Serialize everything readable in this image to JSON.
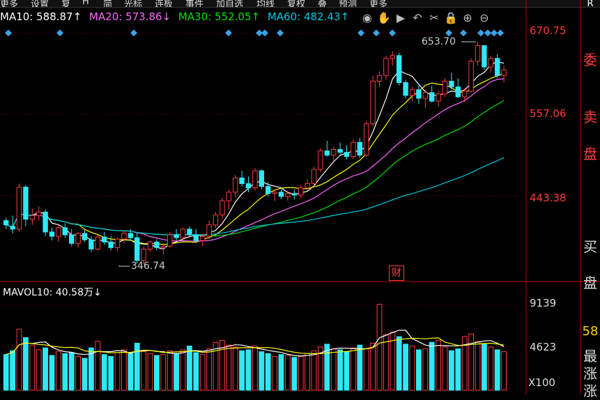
{
  "topbar": {
    "items": [
      "更多",
      "设置",
      "复",
      "H",
      "简",
      "光标",
      "连板",
      "事件",
      "加自选",
      "均线",
      "复权",
      "叠",
      "预测",
      "更多"
    ]
  },
  "legend": {
    "ma10": "MA10: 588.87↑",
    "ma20": "MA20: 573.86↓",
    "ma30": "MA30: 552.05↑",
    "ma60": "MA60: 482.43↑"
  },
  "toolbar": {
    "icons": [
      "eye-icon",
      "hand-icon",
      "play-icon",
      "undo-icon",
      "scissors-icon",
      "lock-icon",
      "zoom-in-icon",
      "zoom-out-icon"
    ]
  },
  "price_axis": {
    "labels": [
      "670.75",
      "557.06",
      "443.38"
    ]
  },
  "volume": {
    "legend": "MAVOL10: 40.58万↓",
    "labels": [
      "9139",
      "4623"
    ],
    "unit": "X100"
  },
  "side": {
    "chars": [
      "委",
      "卖",
      "盘",
      "买",
      "盘",
      "58",
      "最",
      "涨",
      "涨"
    ]
  },
  "annotations": {
    "high": "653.70",
    "low": "346.74",
    "event": "财",
    "corner": "R"
  },
  "colors": {
    "up": "#ff3b3b",
    "down": "#2ee8f5",
    "ma10": "#ffffff",
    "ma20": "#ffff00",
    "ma30": "#ff66ff",
    "ma60": "#00e000",
    "ma_long": "#00c8e0",
    "grid": "#7a0000"
  },
  "chart_data": {
    "type": "candlestick",
    "ylim": [
      346.74,
      670.75
    ],
    "ticks": [
      670.75,
      557.06,
      443.38
    ],
    "candles": [
      [
        408,
        412,
        396,
        402
      ],
      [
        400,
        415,
        390,
        396
      ],
      [
        396,
        460,
        392,
        455
      ],
      [
        455,
        458,
        400,
        410
      ],
      [
        410,
        425,
        402,
        415
      ],
      [
        415,
        428,
        408,
        420
      ],
      [
        420,
        424,
        386,
        392
      ],
      [
        392,
        398,
        380,
        386
      ],
      [
        386,
        402,
        378,
        398
      ],
      [
        398,
        404,
        384,
        388
      ],
      [
        388,
        396,
        372,
        376
      ],
      [
        376,
        392,
        370,
        390
      ],
      [
        390,
        395,
        378,
        381
      ],
      [
        381,
        386,
        364,
        368
      ],
      [
        368,
        388,
        366,
        385
      ],
      [
        385,
        392,
        374,
        378
      ],
      [
        378,
        386,
        366,
        370
      ],
      [
        370,
        384,
        366,
        382
      ],
      [
        382,
        394,
        376,
        390
      ],
      [
        390,
        396,
        380,
        384
      ],
      [
        384,
        390,
        348,
        352
      ],
      [
        352,
        372,
        346.74,
        368
      ],
      [
        368,
        380,
        364,
        378
      ],
      [
        378,
        382,
        366,
        370
      ],
      [
        370,
        376,
        360,
        372
      ],
      [
        372,
        392,
        370,
        388
      ],
      [
        388,
        396,
        380,
        384
      ],
      [
        384,
        398,
        380,
        396
      ],
      [
        396,
        400,
        384,
        388
      ],
      [
        388,
        396,
        378,
        380
      ],
      [
        380,
        390,
        372,
        386
      ],
      [
        386,
        408,
        382,
        402
      ],
      [
        402,
        420,
        398,
        416
      ],
      [
        416,
        440,
        410,
        436
      ],
      [
        436,
        452,
        424,
        448
      ],
      [
        448,
        472,
        440,
        468
      ],
      [
        468,
        478,
        456,
        460
      ],
      [
        460,
        470,
        448,
        454
      ],
      [
        454,
        482,
        450,
        478
      ],
      [
        478,
        480,
        452,
        456
      ],
      [
        456,
        462,
        442,
        446
      ],
      [
        446,
        452,
        436,
        448
      ],
      [
        448,
        452,
        438,
        442
      ],
      [
        442,
        450,
        436,
        446
      ],
      [
        446,
        452,
        438,
        444
      ],
      [
        444,
        458,
        440,
        454
      ],
      [
        454,
        466,
        450,
        460
      ],
      [
        460,
        484,
        456,
        480
      ],
      [
        480,
        510,
        476,
        506
      ],
      [
        506,
        520,
        498,
        500
      ],
      [
        500,
        512,
        492,
        508
      ],
      [
        508,
        518,
        500,
        504
      ],
      [
        504,
        514,
        494,
        498
      ],
      [
        498,
        522,
        494,
        518
      ],
      [
        518,
        524,
        496,
        500
      ],
      [
        500,
        548,
        498,
        544
      ],
      [
        544,
        612,
        540,
        604
      ],
      [
        604,
        618,
        596,
        612
      ],
      [
        612,
        640,
        606,
        636
      ],
      [
        636,
        646,
        626,
        640
      ],
      [
        640,
        644,
        598,
        602
      ],
      [
        602,
        606,
        580,
        584
      ],
      [
        584,
        596,
        576,
        592
      ],
      [
        592,
        600,
        572,
        580
      ],
      [
        580,
        592,
        566,
        588
      ],
      [
        588,
        598,
        574,
        576
      ],
      [
        576,
        590,
        568,
        586
      ],
      [
        586,
        608,
        582,
        604
      ],
      [
        604,
        616,
        592,
        596
      ],
      [
        596,
        608,
        580,
        582
      ],
      [
        582,
        594,
        574,
        590
      ],
      [
        590,
        636,
        588,
        632
      ],
      [
        632,
        660,
        626,
        654
      ],
      [
        654,
        653.7,
        620,
        624
      ],
      [
        624,
        640,
        616,
        636
      ],
      [
        636,
        642,
        608,
        612
      ],
      [
        612,
        626,
        602,
        620
      ]
    ],
    "volumes": [
      3800,
      4200,
      6500,
      5600,
      4800,
      4300,
      4500,
      3700,
      4100,
      3900,
      4000,
      3600,
      3400,
      4500,
      5200,
      3800,
      3600,
      4000,
      4300,
      3900,
      5000,
      4100,
      3900,
      3700,
      3800,
      4200,
      3900,
      4300,
      4700,
      4000,
      3800,
      4400,
      5100,
      5300,
      4800,
      4600,
      4200,
      4300,
      4700,
      4100,
      3900,
      3600,
      3800,
      3700,
      3500,
      3600,
      3900,
      4200,
      4600,
      4900,
      4400,
      4300,
      4100,
      4500,
      4800,
      4400,
      5000,
      9139,
      5900,
      6200,
      5700,
      4900,
      4700,
      4300,
      4400,
      5100,
      5300,
      4600,
      4200,
      4400,
      5700,
      6000,
      5200,
      4900,
      4600,
      4300,
      4100
    ]
  }
}
